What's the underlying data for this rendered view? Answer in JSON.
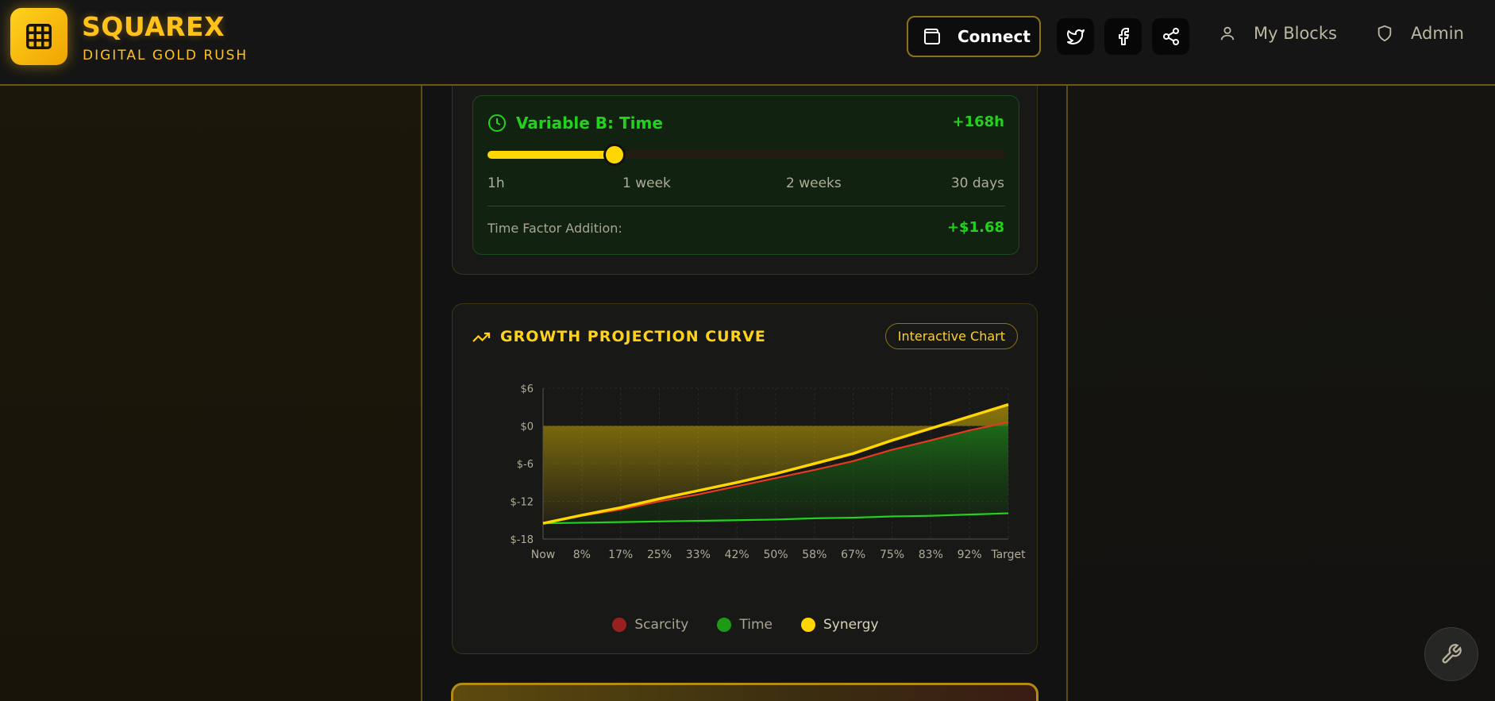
{
  "brand": {
    "title": "SQUAREX",
    "subtitle": "DIGITAL GOLD RUSH"
  },
  "header": {
    "connect_label": "Connect",
    "nav": {
      "my_blocks": "My Blocks",
      "admin": "Admin"
    }
  },
  "variable_b": {
    "title": "Variable B: Time",
    "value": "+168h",
    "slider_fraction": 0.245,
    "ticks": [
      "1h",
      "1 week",
      "2 weeks",
      "30 days"
    ],
    "factor_label": "Time Factor Addition:",
    "factor_value": "+$1.68"
  },
  "chart_card": {
    "title": "GROWTH PROJECTION CURVE",
    "badge": "Interactive Chart"
  },
  "colors": {
    "accent": "#ffd21a",
    "scarcity": "#e53a1f",
    "time": "#22d21c",
    "synergy": "#ffd600"
  },
  "chart_data": {
    "type": "line",
    "categories": [
      "Now",
      "8%",
      "17%",
      "25%",
      "33%",
      "42%",
      "50%",
      "58%",
      "67%",
      "75%",
      "83%",
      "92%",
      "Target"
    ],
    "yticks": [
      "$6",
      "$0",
      "$-6",
      "$-12",
      "$-18"
    ],
    "ylim": [
      -18,
      6
    ],
    "grid": true,
    "legend": "bottom",
    "series": [
      {
        "name": "Scarcity",
        "color": "#e53a1f",
        "values": [
          -15.5,
          -14.3,
          -13.3,
          -12.0,
          -10.9,
          -9.6,
          -8.3,
          -7.0,
          -5.6,
          -3.8,
          -2.3,
          -0.7,
          0.6
        ]
      },
      {
        "name": "Time",
        "color": "#22d21c",
        "values": [
          -15.5,
          -15.4,
          -15.3,
          -15.2,
          -15.1,
          -15.0,
          -14.9,
          -14.7,
          -14.6,
          -14.4,
          -14.3,
          -14.1,
          -13.9
        ]
      },
      {
        "name": "Synergy",
        "color": "#ffd600",
        "values": [
          -15.5,
          -14.2,
          -13.0,
          -11.6,
          -10.3,
          -9.0,
          -7.6,
          -6.0,
          -4.4,
          -2.3,
          -0.4,
          1.5,
          3.4
        ]
      }
    ]
  }
}
